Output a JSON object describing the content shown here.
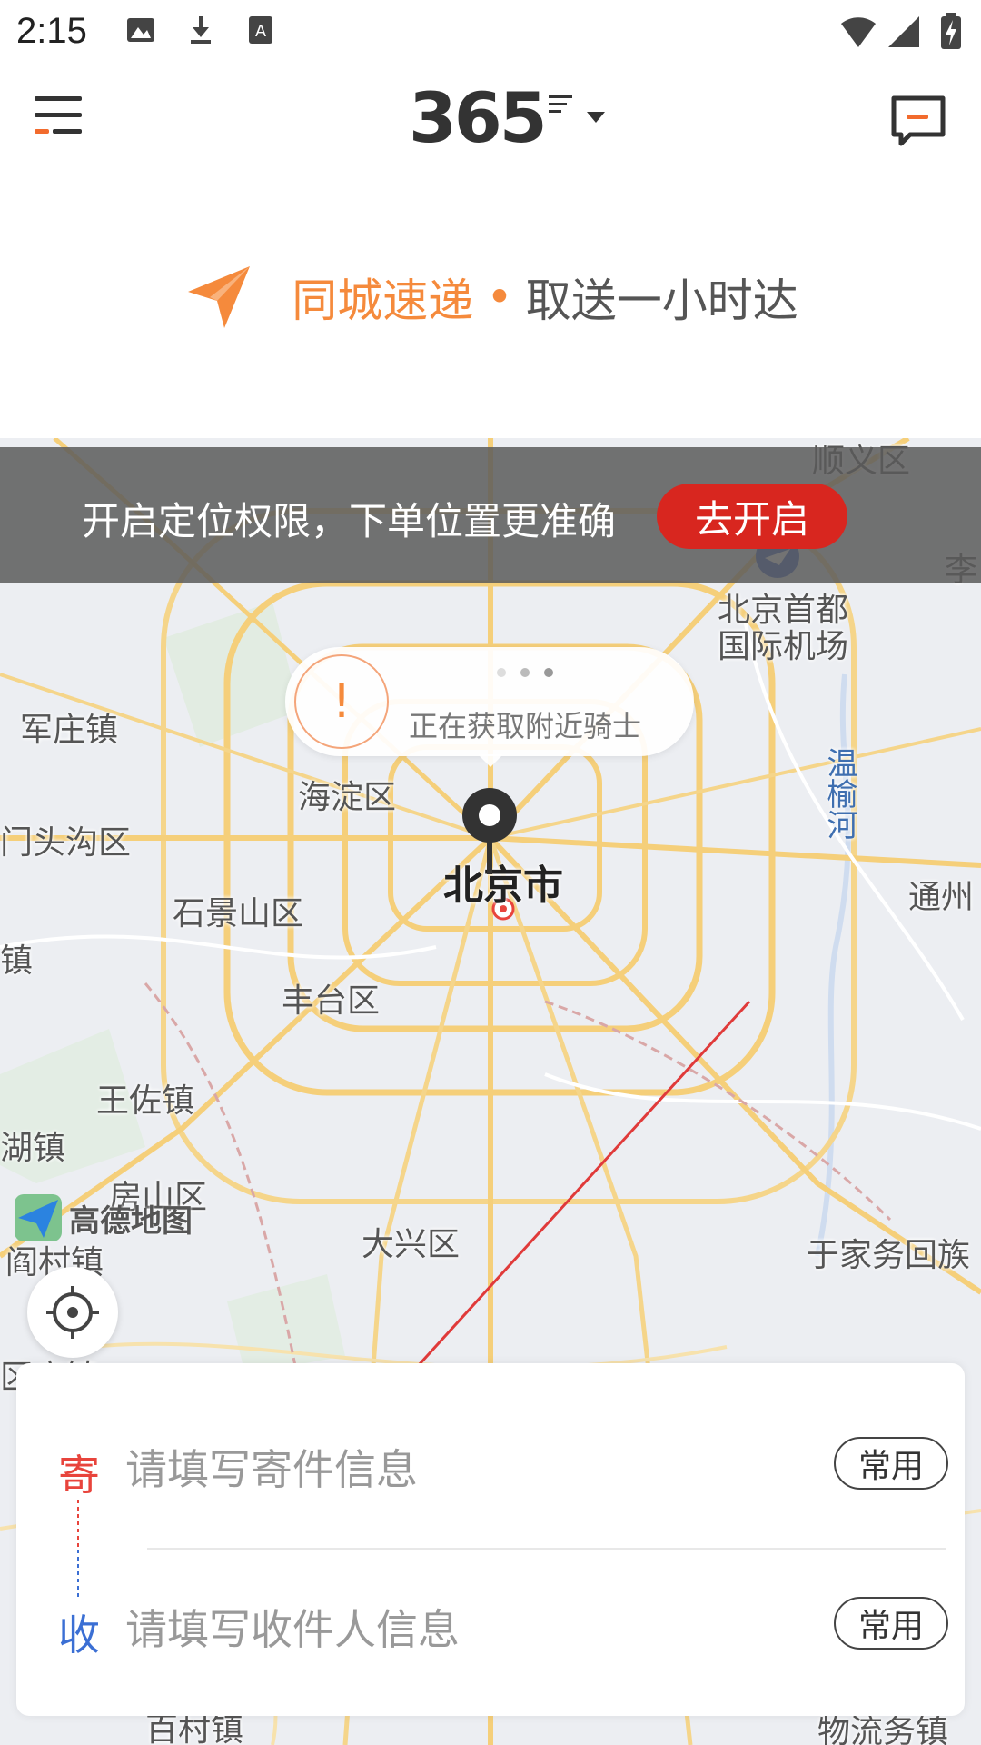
{
  "status_bar": {
    "time": "2:15"
  },
  "header": {
    "logo_text": "365"
  },
  "banner": {
    "title": "同城速递",
    "dot": "•",
    "subtitle": "取送一小时达"
  },
  "permission": {
    "text": "开启定位权限，下单位置更准确",
    "button": "去开启"
  },
  "bubble": {
    "icon_text": "!",
    "text": "正在获取附近骑士"
  },
  "map": {
    "city": "北京市",
    "labels": [
      "顺义区",
      "李",
      "北京首都",
      "国际机场",
      "军庄镇",
      "温榆河",
      "海淀区",
      "门头沟区",
      "通州",
      "石景山区",
      "镇",
      "丰台区",
      "王佐镇",
      "湖镇",
      "房山区",
      "阎村镇",
      "大兴区",
      "于家务回族",
      "区广镇",
      "百村镇",
      "物流务镇"
    ],
    "attribution": "高德地图"
  },
  "address": {
    "send_tag": "寄",
    "send_placeholder": "请填写寄件信息",
    "recv_tag": "收",
    "recv_placeholder": "请填写收件人信息",
    "common_label": "常用"
  },
  "colors": {
    "accent_orange": "#f58a3c",
    "button_red": "#d8261f",
    "send_red": "#e8443c",
    "recv_blue": "#3b6fd4"
  }
}
